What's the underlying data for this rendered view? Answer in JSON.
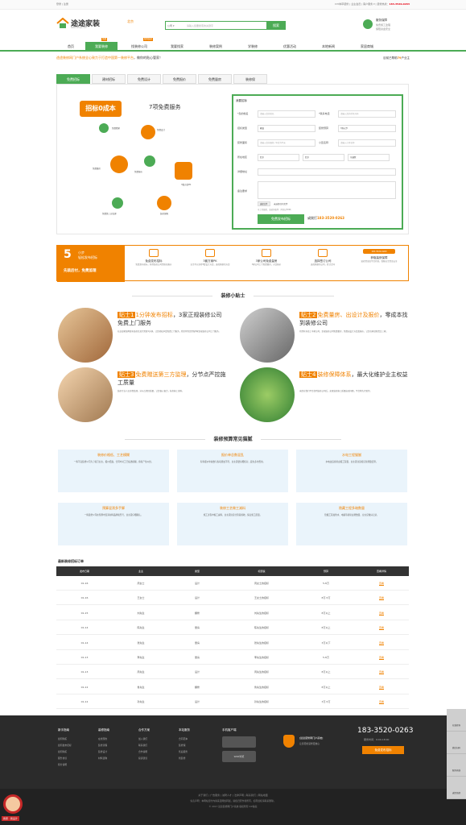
{
  "topbar": {
    "left": "登录 | 注册",
    "right_items": "DIY种草装修 | 业主会员 | 客户服务 ▾ | ",
    "phone_label": "装修热线：",
    "phone": "183-3520-0263"
  },
  "logo": {
    "title": "途途家装",
    "sub": "www.tutujz.com"
  },
  "city": "北京",
  "search": {
    "select": "公司 ▾",
    "placeholder": "请输入您要搜索的关键字",
    "button": "搜索"
  },
  "header_badge": {
    "title": "服务保障",
    "line1": "免费施工监理",
    "line2": "保障资金安全"
  },
  "nav": {
    "items": [
      "首页",
      "我要装修",
      "找装修公司",
      "我要找家",
      "装修案例",
      "学装修",
      "优惠活动",
      "本地新闻",
      "家居商城"
    ],
    "tags": [
      "免费",
      "助你装修"
    ]
  },
  "slogan": {
    "prefix": "途途装修网门户系统全心致力于打造",
    "accent": "中国第一装修平台",
    "suffix": "，做你的贴心管家！",
    "right_prefix": "目前已帮助",
    "right_num": "79",
    "right_suffix": "户业主"
  },
  "tabs": [
    "免费招标",
    "建材招标",
    "免费设计",
    "免费报价",
    "免费量房",
    "装修保"
  ],
  "zhaobiao": {
    "badge": "招标0成本",
    "services": "7项免费服务",
    "items": [
      "免费看家",
      "免费设计",
      "免费量房",
      "免费报价",
      "3套方案PK",
      "免费第三方监理",
      "装修保障"
    ]
  },
  "form": {
    "title": "我要招标",
    "labels": {
      "name": "*您的姓名",
      "phone": "*联系电话",
      "type": "招标类型",
      "budget": "装修预算",
      "area": "装修面积",
      "community": "小区名称",
      "region": "所在地区",
      "address": "详细地址",
      "note": "备注要求"
    },
    "placeholders": {
      "name": "请输入您的姓名",
      "phone": "请输入您的手机号码",
      "area": "请输入您的面积, 单位为平米",
      "community": "请输入小区名称"
    },
    "values": {
      "type": "家装",
      "budget": "3万以下",
      "province": "北京",
      "city": "北京",
      "district": "东城区"
    },
    "file_btn": "选择文件",
    "file_text": "未选择任何文件",
    "file_tip": "可上传图纸、装修风格等（不超过5MB）",
    "submit": "免费发布招标",
    "or_call": "或拨打",
    "phone": "183-3520-0263"
  },
  "steps": {
    "lead_num": "5",
    "lead_a": "小步",
    "lead_b": "轻松发布招标",
    "lead_c": "先装后付，免费监理",
    "items": [
      {
        "t": "免费发布招标",
        "d": "免费发布招标，获得装修公司资质和报价"
      },
      {
        "t": "3套方案PK",
        "d": "业主可以获得3套设计方案，选择满意的方案"
      },
      {
        "t": "3家公司免费量房",
        "d": "3家公司上门免费量房，对比报价"
      },
      {
        "t": "选择签订公司",
        "d": "选择满意的公司，签订合同"
      },
      {
        "t": "获取装修保障",
        "d": "装修资金由平台托管，保障业主资金安全"
      }
    ],
    "hotline": "183-3520-0263"
  },
  "tips_title": "装修小贴士",
  "tips": [
    {
      "badge": "贴士1",
      "accent": "1分钟发布招标",
      "title": "，3家正规装修公司免费上门服务",
      "desc": "在途途家装网发布装修信息只需要1分钟，让您轻松享受免费上门服务，我们将为您匹配3家正规装修公司上门服务。"
    },
    {
      "badge": "贴士2",
      "accent": "免费量房、出设计及报价",
      "title": "，零成本找到装修公司",
      "desc": "已经有多达上千家公司，正规装修公司免费量房，免费出设计方案及报价，让您在家就能货比三家。"
    },
    {
      "badge": "贴士3",
      "accent": "免费赠送第三方监理",
      "title": "，分节点严控施工质量",
      "desc": "装修专业人员全程监理，分节点把控质量，让您省心省力，杜绝偷工减料。"
    },
    {
      "badge": "贴士4",
      "accent": "装修保障体系",
      "title": "，最大化维护业主权益",
      "desc": "当您在我们平台找到装修公司后，如果装修施工质量出现问题，平台将先行赔付。"
    }
  ],
  "faq_title": "装修预算常见猫腻",
  "faq": [
    {
      "t": "装修价格低、工艺模糊",
      "d": "一些不良装修公司为了吸引业主，报价低廉，合同中对工艺描述模糊，容易产生纠纷。"
    },
    {
      "t": "报价单总数混乱",
      "d": "有些报价单总数与各项累加不符，业主需要仔细核对，避免多付费用。"
    },
    {
      "t": "水电工程猫腻",
      "d": "水电改造容易虚报工程量，业主需注意按实际测量结算。"
    },
    {
      "t": "预算混淆多手脚",
      "d": "一些装修公司在预算中混淆材料品牌和型号，业主需仔细确认。"
    },
    {
      "t": "装修工艺做工减料",
      "d": "施工过程中偷工减料，业主需注意分阶段验收，保证施工质量。"
    },
    {
      "t": "隐藏工程多暗数量",
      "d": "隐藏工程如防水、电路等容易虚增数量，业主应做好记录。"
    }
  ],
  "orders": {
    "title": "最新装修招标订单",
    "headers": [
      "发布日期",
      "业主",
      "类型",
      "标题说",
      "预算",
      "查看详情"
    ],
    "rows": [
      [
        "01-16",
        "周女士",
        "设计",
        "周女士的招标",
        "5-8万",
        "查看"
      ],
      [
        "01-16",
        "王女士",
        "设计",
        "王女士的招标",
        "8万-5万",
        "查看"
      ],
      [
        "01-15",
        "刘先生",
        "翻修",
        "刘先生的招标",
        "8万以上",
        "查看"
      ],
      [
        "01-14",
        "陈先生",
        "量房",
        "陈先生的招标",
        "8万以上",
        "查看"
      ],
      [
        "01-14",
        "张先生",
        "量房",
        "张先生的招标",
        "3万以下",
        "查看"
      ],
      [
        "01-13",
        "李先生",
        "量房",
        "李先生的招标",
        "5-8万",
        "查看"
      ],
      [
        "01-13",
        "周先生",
        "设计",
        "周先生的招标",
        "8万以上",
        "查看"
      ],
      [
        "01-12",
        "鲁先生",
        "翻修",
        "鲁先生的招标",
        "8万以上",
        "查看"
      ],
      [
        "01-12",
        "孙先生",
        "设计",
        "孙先生的招标",
        "3万-5万",
        "查看"
      ],
      [
        "01-11",
        "刘女士",
        "设计",
        "刘女士的招标",
        "8万以上",
        "查看"
      ],
      [
        "01-11",
        "刘先生",
        "量房",
        "刘先生的招标",
        "8万以上",
        "查看"
      ]
    ]
  },
  "footer": {
    "cols": [
      {
        "h": "新手指南",
        "i": [
          "如何购买",
          "如何发布招标",
          "如何购买",
          "服务协议",
          "积分说明"
        ]
      },
      {
        "h": "装修指南",
        "i": [
          "在线预约",
          "装修流程",
          "装修设计",
          "材料选购"
        ]
      },
      {
        "h": "合作方案",
        "i": [
          "加入我们",
          "联系我们",
          "合作说明",
          "投诉建议"
        ]
      },
      {
        "h": "本站服务",
        "i": [
          "合同范本",
          "装修保",
          "售后服务",
          "找装修"
        ]
      }
    ],
    "app": "手机客户端",
    "wap": "WAP浏览",
    "guard": "[途途装修网门户系统]",
    "guard_sub": "让您轻松装修更放心",
    "hotline": "183-3520-0263",
    "hours": "服务时间：9:00-18:00",
    "cta": "免费发布招标"
  },
  "bottom": {
    "links": "关于我们 | 广告服务 | 诚聘人才 | 法律声明 | 联系我们 | 网站地图",
    "line2": "免责声明：本网站部分内容来自网络转载，版权归原作者所有，如有侵权请联系删除。",
    "line3": "© 2017 途途装修网门户系统 版权所有 ICP备案"
  },
  "side": [
    "在线咨询",
    "微信扫码",
    "服务热线",
    "返回顶部"
  ],
  "mascot": "我家 · 我设计"
}
